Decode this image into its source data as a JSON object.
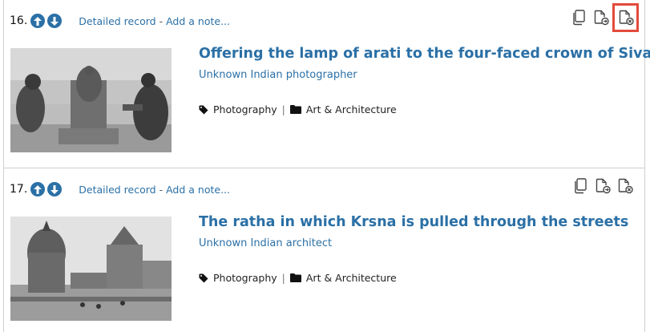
{
  "records": [
    {
      "number": "16.",
      "detailed_label": "Detailed record",
      "separator": " - ",
      "note_label": "Add a note...",
      "title": "Offering the lamp of arati to the four-faced crown of Siva",
      "creator": "Unknown Indian photographer",
      "classification": "Photography",
      "collection": "Art & Architecture"
    },
    {
      "number": "17.",
      "detailed_label": "Detailed record",
      "separator": " - ",
      "note_label": "Add a note...",
      "title": "The ratha in which Krsna is pulled through the streets",
      "creator": "Unknown Indian architect",
      "classification": "Photography",
      "collection": "Art & Architecture"
    }
  ],
  "meta_divider": "|",
  "icons": {
    "move_up": "arrow-up-circle-icon",
    "move_down": "arrow-down-circle-icon",
    "copy": "copy-icon",
    "add_to_set": "document-add-icon",
    "remove": "document-remove-icon",
    "classification": "tag-icon",
    "collection": "folder-icon"
  },
  "colors": {
    "link": "#2b70a6",
    "highlight": "#e34b3b"
  }
}
